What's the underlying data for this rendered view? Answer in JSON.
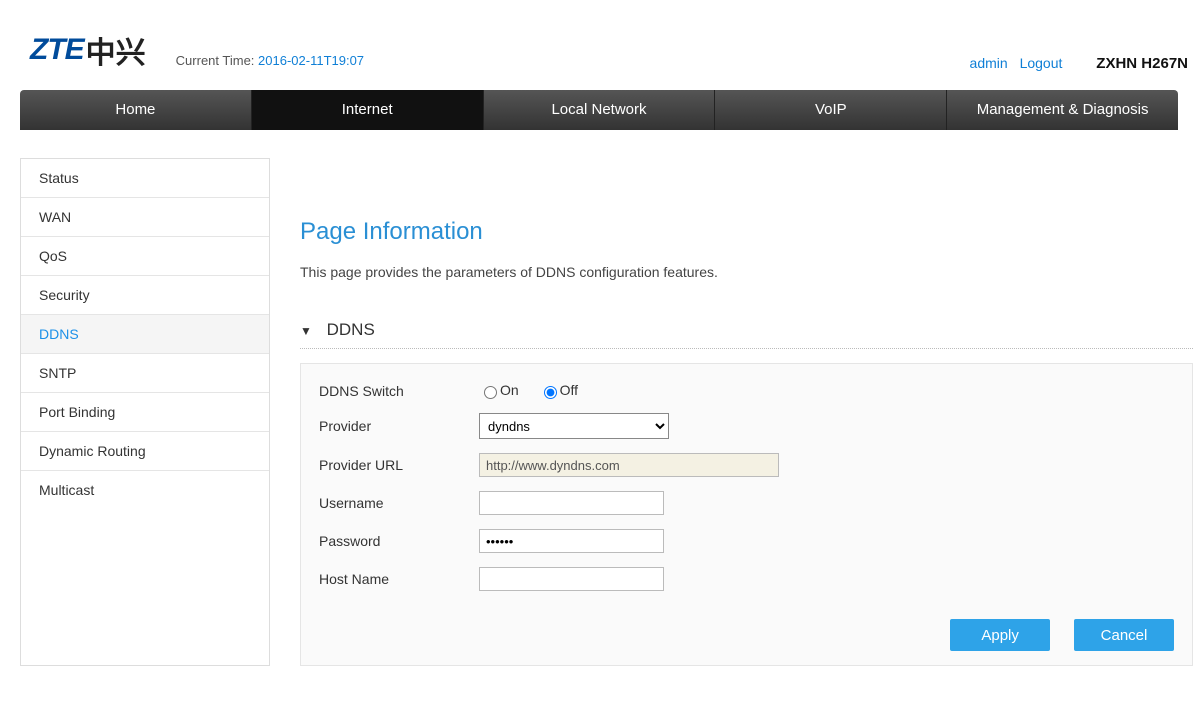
{
  "header": {
    "logo_latin": "ZTE",
    "logo_cn": "中兴",
    "time_label": "Current Time: ",
    "time_value": "2016-02-11T19:07",
    "user_link": "admin",
    "logout_link": "Logout",
    "model": "ZXHN H267N"
  },
  "nav": {
    "items": [
      "Home",
      "Internet",
      "Local Network",
      "VoIP",
      "Management & Diagnosis"
    ],
    "active_index": 1
  },
  "sidebar": {
    "items": [
      "Status",
      "WAN",
      "QoS",
      "Security",
      "DDNS",
      "SNTP",
      "Port Binding",
      "Dynamic Routing",
      "Multicast"
    ],
    "active_index": 4
  },
  "page": {
    "title": "Page Information",
    "description": "This page provides the parameters of DDNS configuration features.",
    "section_title": "DDNS"
  },
  "form": {
    "switch_label": "DDNS Switch",
    "switch_on": "On",
    "switch_off": "Off",
    "switch_value": "Off",
    "provider_label": "Provider",
    "provider_value": "dyndns",
    "provider_url_label": "Provider URL",
    "provider_url_value": "http://www.dyndns.com",
    "username_label": "Username",
    "username_value": "",
    "password_label": "Password",
    "password_value": "••••••",
    "hostname_label": "Host Name",
    "hostname_value": "",
    "apply_btn": "Apply",
    "cancel_btn": "Cancel"
  }
}
